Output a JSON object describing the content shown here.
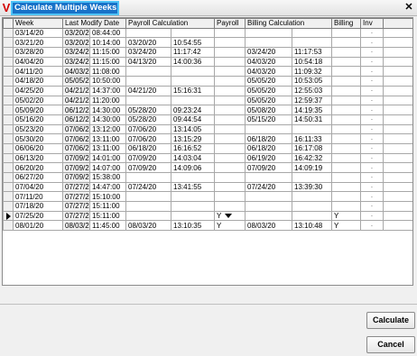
{
  "window": {
    "title": "Calculate Multiple Weeks",
    "app_icon": "V",
    "close_glyph": "✕"
  },
  "columns": [
    "Week",
    "Last Modify Date",
    "Payroll Calculation",
    "",
    "Payroll",
    "Billing Calculation",
    "",
    "Billing",
    "Inv"
  ],
  "rows": [
    {
      "week": "03/14/20",
      "lm_date": "03/20/20",
      "lm_time": "08:44:00",
      "pc_date": "",
      "pc_time": "",
      "payroll": "",
      "bc_date": "",
      "bc_time": "",
      "billing": "",
      "inv": "·"
    },
    {
      "week": "03/21/20",
      "lm_date": "03/20/20",
      "lm_time": "10:14:00",
      "pc_date": "03/20/20",
      "pc_time": "10:54:55",
      "payroll": "",
      "bc_date": "",
      "bc_time": "",
      "billing": "",
      "inv": "·"
    },
    {
      "week": "03/28/20",
      "lm_date": "03/24/20",
      "lm_time": "11:15:00",
      "pc_date": "03/24/20",
      "pc_time": "11:17:42",
      "payroll": "",
      "bc_date": "03/24/20",
      "bc_time": "11:17:53",
      "billing": "",
      "inv": "·"
    },
    {
      "week": "04/04/20",
      "lm_date": "03/24/20",
      "lm_time": "11:15:00",
      "pc_date": "04/13/20",
      "pc_time": "14:00:36",
      "payroll": "",
      "bc_date": "04/03/20",
      "bc_time": "10:54:18",
      "billing": "",
      "inv": "·"
    },
    {
      "week": "04/11/20",
      "lm_date": "04/03/20",
      "lm_time": "11:08:00",
      "pc_date": "",
      "pc_time": "",
      "payroll": "",
      "bc_date": "04/03/20",
      "bc_time": "11:09:32",
      "billing": "",
      "inv": "·"
    },
    {
      "week": "04/18/20",
      "lm_date": "05/05/20",
      "lm_time": "10:50:00",
      "pc_date": "",
      "pc_time": "",
      "payroll": "",
      "bc_date": "05/05/20",
      "bc_time": "10:53:05",
      "billing": "",
      "inv": "·"
    },
    {
      "week": "04/25/20",
      "lm_date": "04/21/20",
      "lm_time": "14:37:00",
      "pc_date": "04/21/20",
      "pc_time": "15:16:31",
      "payroll": "",
      "bc_date": "05/05/20",
      "bc_time": "12:55:03",
      "billing": "",
      "inv": "·"
    },
    {
      "week": "05/02/20",
      "lm_date": "04/21/20",
      "lm_time": "11:20:00",
      "pc_date": "",
      "pc_time": "",
      "payroll": "",
      "bc_date": "05/05/20",
      "bc_time": "12:59:37",
      "billing": "",
      "inv": "·"
    },
    {
      "week": "05/09/20",
      "lm_date": "06/12/20",
      "lm_time": "14:30:00",
      "pc_date": "05/28/20",
      "pc_time": "09:23:24",
      "payroll": "",
      "bc_date": "05/08/20",
      "bc_time": "14:19:35",
      "billing": "",
      "inv": "·"
    },
    {
      "week": "05/16/20",
      "lm_date": "06/12/20",
      "lm_time": "14:30:00",
      "pc_date": "05/28/20",
      "pc_time": "09:44:54",
      "payroll": "",
      "bc_date": "05/15/20",
      "bc_time": "14:50:31",
      "billing": "",
      "inv": "·"
    },
    {
      "week": "05/23/20",
      "lm_date": "07/06/20",
      "lm_time": "13:12:00",
      "pc_date": "07/06/20",
      "pc_time": "13:14:05",
      "payroll": "",
      "bc_date": "",
      "bc_time": "",
      "billing": "",
      "inv": "·"
    },
    {
      "week": "05/30/20",
      "lm_date": "07/06/20",
      "lm_time": "13:11:00",
      "pc_date": "07/06/20",
      "pc_time": "13:15:29",
      "payroll": "",
      "bc_date": "06/18/20",
      "bc_time": "16:11:33",
      "billing": "",
      "inv": "·"
    },
    {
      "week": "06/06/20",
      "lm_date": "07/06/20",
      "lm_time": "13:11:00",
      "pc_date": "06/18/20",
      "pc_time": "16:16:52",
      "payroll": "",
      "bc_date": "06/18/20",
      "bc_time": "16:17:08",
      "billing": "",
      "inv": "·"
    },
    {
      "week": "06/13/20",
      "lm_date": "07/09/20",
      "lm_time": "14:01:00",
      "pc_date": "07/09/20",
      "pc_time": "14:03:04",
      "payroll": "",
      "bc_date": "06/19/20",
      "bc_time": "16:42:32",
      "billing": "",
      "inv": "·"
    },
    {
      "week": "06/20/20",
      "lm_date": "07/09/20",
      "lm_time": "14:07:00",
      "pc_date": "07/09/20",
      "pc_time": "14:09:06",
      "payroll": "",
      "bc_date": "07/09/20",
      "bc_time": "14:09:19",
      "billing": "",
      "inv": "·"
    },
    {
      "week": "06/27/20",
      "lm_date": "07/09/20",
      "lm_time": "15:38:00",
      "pc_date": "",
      "pc_time": "",
      "payroll": "",
      "bc_date": "",
      "bc_time": "",
      "billing": "",
      "inv": "·"
    },
    {
      "week": "07/04/20",
      "lm_date": "07/27/20",
      "lm_time": "14:47:00",
      "pc_date": "07/24/20",
      "pc_time": "13:41:55",
      "payroll": "",
      "bc_date": "07/24/20",
      "bc_time": "13:39:30",
      "billing": "",
      "inv": "·"
    },
    {
      "week": "07/11/20",
      "lm_date": "07/27/20",
      "lm_time": "15:10:00",
      "pc_date": "",
      "pc_time": "",
      "payroll": "",
      "bc_date": "",
      "bc_time": "",
      "billing": "",
      "inv": "·"
    },
    {
      "week": "07/18/20",
      "lm_date": "07/27/20",
      "lm_time": "15:11:00",
      "pc_date": "",
      "pc_time": "",
      "payroll": "",
      "bc_date": "",
      "bc_time": "",
      "billing": "",
      "inv": "·"
    },
    {
      "week": "07/25/20",
      "lm_date": "07/27/20",
      "lm_time": "15:11:00",
      "pc_date": "",
      "pc_time": "",
      "payroll": "Y",
      "bc_date": "",
      "bc_time": "",
      "billing": "Y",
      "inv": "·",
      "current": true,
      "combo": true
    },
    {
      "week": "08/01/20",
      "lm_date": "08/03/20",
      "lm_time": "11:45:00",
      "pc_date": "08/03/20",
      "pc_time": "13:10:35",
      "payroll": "Y",
      "bc_date": "08/03/20",
      "bc_time": "13:10:48",
      "billing": "Y",
      "inv": "·"
    }
  ],
  "buttons": {
    "calculate": "Calculate",
    "cancel": "Cancel"
  }
}
